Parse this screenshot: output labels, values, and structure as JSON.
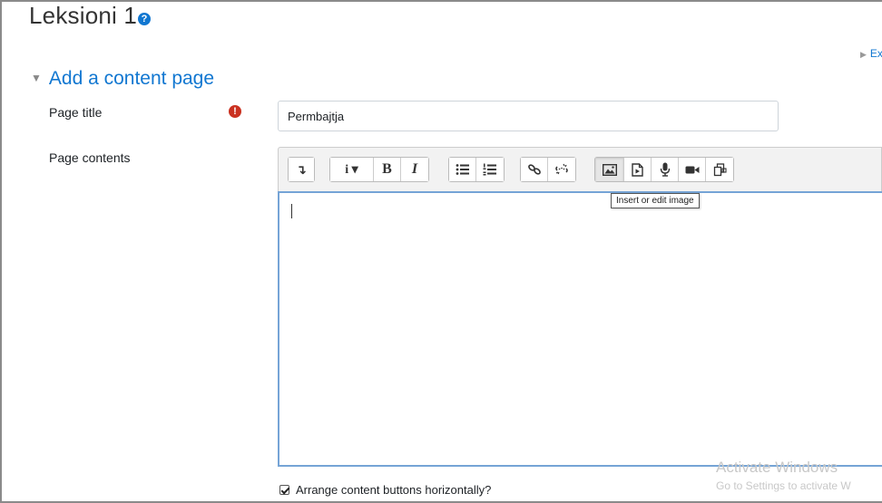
{
  "page": {
    "title": "Leksioni 1",
    "help_icon_label": "?",
    "expand_all_label": "Ex"
  },
  "section": {
    "header": "Add a content page",
    "expanded": true
  },
  "fields": {
    "page_title_label": "Page title",
    "page_title_value": "Permbajtja",
    "required_icon_label": "!",
    "page_contents_label": "Page contents"
  },
  "toolbar": {
    "groups": [
      {
        "buttons": [
          {
            "icon": "collapse-toggle-icon",
            "glyph": "↴"
          }
        ]
      },
      {
        "buttons": [
          {
            "icon": "paragraph-style-icon",
            "glyph": "i ▾"
          },
          {
            "icon": "bold-icon",
            "glyph": "B"
          },
          {
            "icon": "italic-icon",
            "glyph": "I"
          }
        ]
      },
      {
        "buttons": [
          {
            "icon": "unordered-list-icon"
          },
          {
            "icon": "ordered-list-icon"
          }
        ]
      },
      {
        "buttons": [
          {
            "icon": "link-icon"
          },
          {
            "icon": "unlink-icon"
          }
        ]
      },
      {
        "buttons": [
          {
            "icon": "image-icon",
            "active": true
          },
          {
            "icon": "media-icon"
          },
          {
            "icon": "record-audio-icon"
          },
          {
            "icon": "record-video-icon"
          },
          {
            "icon": "manage-files-icon"
          }
        ]
      }
    ],
    "tooltip": "Insert or edit image"
  },
  "options": {
    "arrange_label": "Arrange content buttons horizontally?",
    "arrange_checked": true
  },
  "watermark": {
    "line1": "Activate Windows",
    "line2": "Go to Settings to activate W"
  },
  "colors": {
    "accent": "#1177d1",
    "required": "#ca3120",
    "editor_focus": "#75a4d6"
  }
}
